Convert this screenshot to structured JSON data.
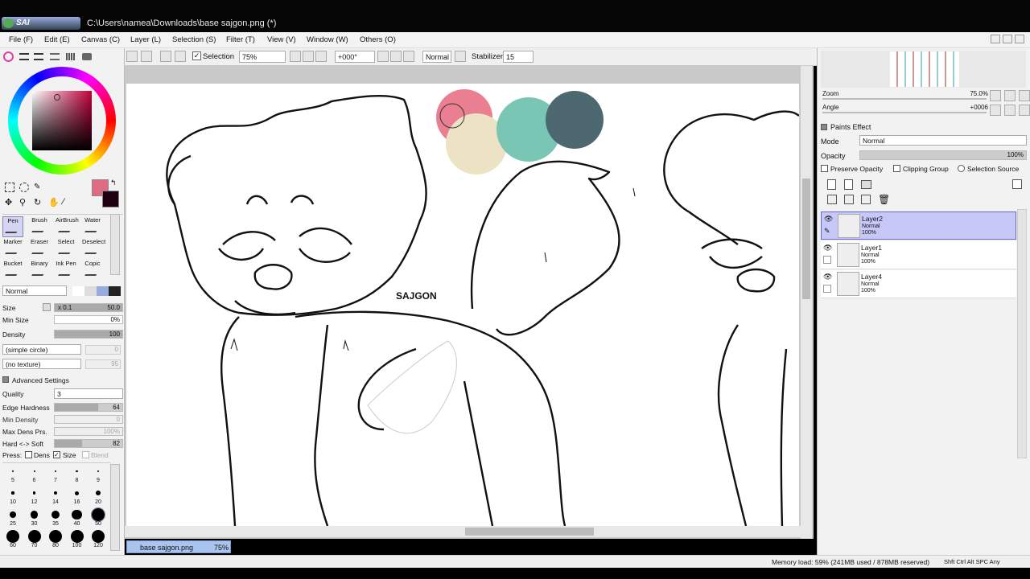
{
  "window": {
    "title": "C:\\Users\\namea\\Downloads\\base sajgon.png (*)",
    "logo": "SAI"
  },
  "menu": [
    "File (F)",
    "Edit (E)",
    "Canvas (C)",
    "Layer (L)",
    "Selection (S)",
    "Filter (T)",
    "View (V)",
    "Window (W)",
    "Others (O)"
  ],
  "toolbar": {
    "selection_label": "Selection",
    "zoom": "75%",
    "angle": "+000°",
    "mode": "Normal",
    "stabilizer_label": "Stabilizer",
    "stabilizer": "15"
  },
  "colors": {
    "primary": "#e06b82",
    "secondary": "#200010"
  },
  "tools": [
    {
      "label": "Pen",
      "icon": "pen-icon"
    },
    {
      "label": "Brush",
      "icon": "brush-icon"
    },
    {
      "label": "AirBrush",
      "icon": "airbrush-icon"
    },
    {
      "label": "Water",
      "icon": "water-icon"
    },
    {
      "label": "Marker",
      "icon": "marker-icon"
    },
    {
      "label": "Eraser",
      "icon": "eraser-icon"
    },
    {
      "label": "Select",
      "icon": "select-icon"
    },
    {
      "label": "Deselect",
      "icon": "deselect-icon"
    },
    {
      "label": "Bucket",
      "icon": "bucket-icon"
    },
    {
      "label": "Binary",
      "icon": "binary-icon"
    },
    {
      "label": "Ink Pen",
      "icon": "ink-pen-icon"
    },
    {
      "label": "Copic",
      "icon": "copic-icon"
    }
  ],
  "brush": {
    "blend_mode": "Normal",
    "size_label": "Size",
    "size_mult": "x 0.1",
    "size": "50.0",
    "min_size_label": "Min Size",
    "min_size": "0%",
    "density_label": "Density",
    "density": "100",
    "shape": "(simple circle)",
    "shape_value": "0",
    "texture": "(no texture)",
    "texture_value": "95",
    "advanced_label": "Advanced Settings",
    "quality_label": "Quality",
    "quality": "3",
    "edge_hardness_label": "Edge Hardness",
    "edge_hardness": "64",
    "min_density_label": "Min Density",
    "min_density": "0",
    "max_dens_label": "Max Dens Prs.",
    "max_dens": "100%",
    "hard_soft_label": "Hard <-> Soft",
    "hard_soft": "82",
    "press_label": "Press:",
    "dens_label": "Dens",
    "size_chk_label": "Size",
    "blend_label": "Blend"
  },
  "brush_sizes": [
    "5",
    "6",
    "7",
    "8",
    "9",
    "10",
    "12",
    "14",
    "16",
    "20",
    "25",
    "30",
    "35",
    "40",
    "50",
    "60",
    "70",
    "80",
    "100",
    "120"
  ],
  "navigator": {
    "zoom_label": "Zoom",
    "zoom": "75.0%",
    "angle_label": "Angle",
    "angle": "+0006"
  },
  "paints_effect": {
    "label": "Paints Effect",
    "mode_label": "Mode",
    "mode": "Normal",
    "opacity_label": "Opacity",
    "opacity": "100%",
    "preserve_opacity": "Preserve Opacity",
    "clipping_group": "Clipping Group",
    "selection_source": "Selection Source"
  },
  "layers": [
    {
      "name": "Layer2",
      "mode": "Normal",
      "opacity": "100%",
      "selected": true
    },
    {
      "name": "Layer1",
      "mode": "Normal",
      "opacity": "100%",
      "selected": false
    },
    {
      "name": "Layer4",
      "mode": "Normal",
      "opacity": "100%",
      "selected": false
    }
  ],
  "doc_tab": {
    "name": "base sajgon.png",
    "zoom": "75%"
  },
  "status": {
    "memory": "Memory load: 59% (241MB used / 878MB reserved)",
    "keys": "Shft Ctrl Alt SPC Any"
  },
  "canvas_text": "SAJGON",
  "palette_swatches": [
    "#ea7f91",
    "#ece2c4",
    "#78c6b3",
    "#4e6872"
  ]
}
